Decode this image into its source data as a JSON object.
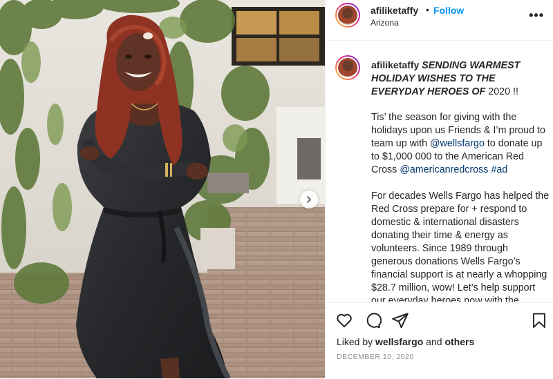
{
  "post": {
    "username": "afiliketaffy",
    "separator": "•",
    "follow_label": "Follow",
    "location": "Arizona",
    "more_label": "•••"
  },
  "caption": {
    "username": "afiliketaffy",
    "headline": "SENDING WARMEST HOLIDAY WISHES TO THE EVERYDAY HEROES OF",
    "headline_year": "2020 !!",
    "p1_a": "Tis’ the season for giving with the holidays upon us Friends & I’m proud to team up with ",
    "mention_wellsfargo": "@wellsfargo",
    "p1_b": " to donate up to $1,000 000 to the American Red Cross ",
    "mention_redcross": "@americanredcross",
    "hashtag_ad": "#ad",
    "p2": "For decades Wells Fargo has helped the Red Cross prepare for + respond to domestic & international disasters donating their time & energy as volunteers. Since 1989 through generous donations Wells Fargo’s financial support is at nearly a whopping $28.7 million, wow! Let’s help support our everyday heroes now with the continued uncertainty of"
  },
  "engagement": {
    "liked_by_prefix": "Liked by ",
    "liked_by_user": "wellsfargo",
    "liked_by_mid": " and ",
    "liked_by_others": "others",
    "date": "DECEMBER 10, 2020"
  },
  "icons": {
    "like": "heart-icon",
    "comment": "comment-icon",
    "share": "share-icon",
    "save": "bookmark-icon",
    "carousel_next": "chevron-right-icon"
  },
  "colors": {
    "follow_blue": "#0095f6",
    "mention_blue": "#00376b",
    "meta_gray": "#8e8e8e"
  }
}
